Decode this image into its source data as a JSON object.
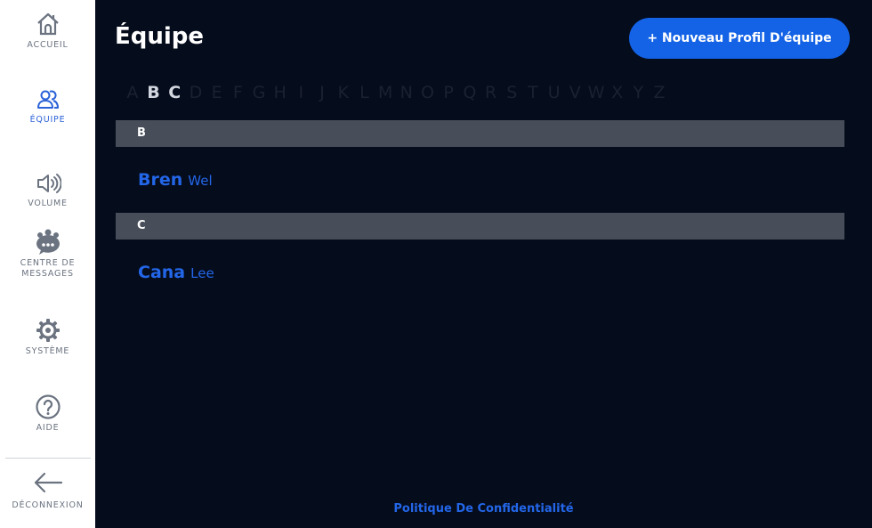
{
  "sidebar": {
    "items": [
      {
        "label": "ACCUEIL",
        "icon": "home-icon"
      },
      {
        "label": "ÉQUIPE",
        "icon": "team-icon"
      },
      {
        "label": "VOLUME",
        "icon": "volume-icon"
      },
      {
        "label": "CENTRE DE",
        "label2": "MESSAGES",
        "icon": "message-center-icon"
      },
      {
        "label": "SYSTÈME",
        "icon": "gear-icon"
      },
      {
        "label": "AIDE",
        "icon": "help-icon"
      }
    ],
    "logout": {
      "label": "DÉCONNEXION",
      "icon": "arrow-left-icon"
    }
  },
  "header": {
    "title": "Équipe",
    "new_button": "+ Nouveau Profil D'équipe"
  },
  "alphabet": {
    "letters": [
      "A",
      "B",
      "C",
      "D",
      "E",
      "F",
      "G",
      "H",
      "I",
      "J",
      "K",
      "L",
      "M",
      "N",
      "O",
      "P",
      "Q",
      "R",
      "S",
      "T",
      "U",
      "V",
      "W",
      "X",
      "Y",
      "Z"
    ],
    "available": [
      "B",
      "C"
    ]
  },
  "groups": [
    {
      "letter": "B",
      "contacts": [
        {
          "first": "Bren",
          "last": "Wel"
        }
      ]
    },
    {
      "letter": "C",
      "contacts": [
        {
          "first": "Cana",
          "last": "Lee"
        }
      ]
    }
  ],
  "footer": {
    "privacy": "Politique De Confidentialité"
  },
  "colors": {
    "background": "#050c1c",
    "accent": "#1463e6",
    "sidebar_active": "#2b62d8",
    "group_header": "#474e5a"
  }
}
